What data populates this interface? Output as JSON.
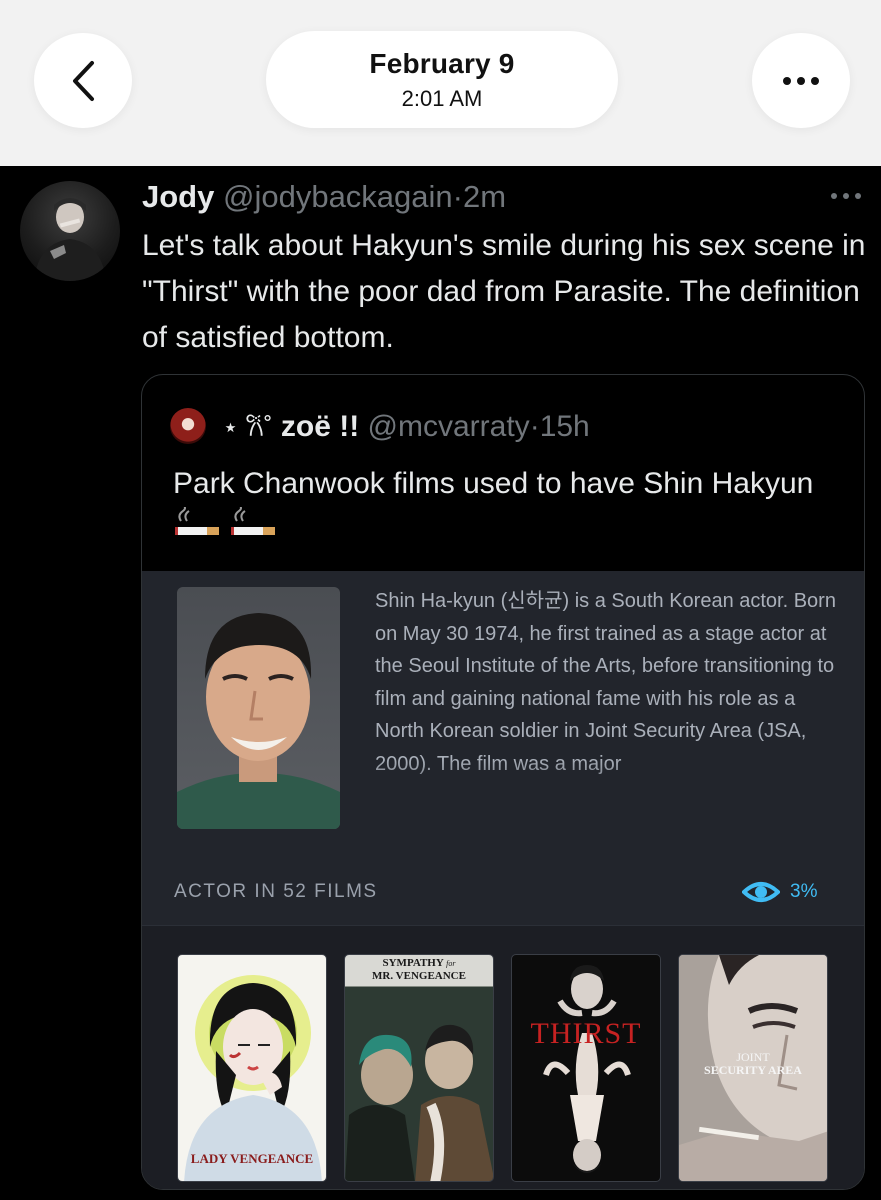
{
  "header": {
    "back_icon": "chevron-left-icon",
    "date": "February 9",
    "time": "2:01 AM",
    "more_icon": "more-horizontal-icon"
  },
  "tweet": {
    "author_name": "Jody",
    "handle": "@jodybackagain",
    "separator": "·",
    "age": "2m",
    "text": "Let's talk about Hakyun's smile during his sex scene in \"Thirst\" with the poor dad from Parasite. The definition of satisfied bottom.",
    "quote": {
      "decor": "⋆ 𐙚˚",
      "name": "zoë !!",
      "handle": "@mcvarraty",
      "separator": "·",
      "age": "15h",
      "text": "Park Chanwook films used to have Shin Hakyun",
      "emoji_icon": "cigarette-icon",
      "card": {
        "bio": "Shin Ha-kyun (신하균) is a South Korean actor. Born on May 30 1974, he first trained as a stage actor at the Seoul Institute of the Arts, before transitioning to film and gaining national fame with his role as a North Korean soldier in Joint Security Area (JSA, 2000). The film was a major",
        "films_label": "ACTOR IN 52 FILMS",
        "watched_pct": "3%",
        "accent_color": "#40bcf4",
        "posters": [
          {
            "title": "LADY VENGEANCE"
          },
          {
            "title": "SYMPATHY",
            "title_small": "for",
            "title_line2": "MR. VENGEANCE"
          },
          {
            "title": "THIRST"
          },
          {
            "title": "JOINT",
            "title_line2": "SECURITY AREA"
          }
        ]
      }
    }
  }
}
